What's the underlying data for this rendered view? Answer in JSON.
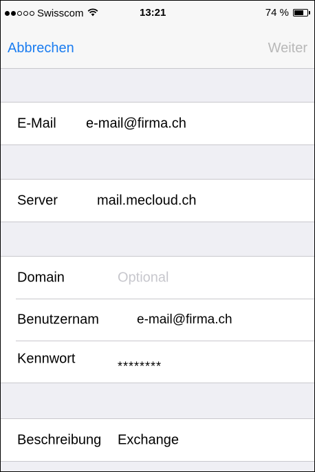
{
  "status_bar": {
    "carrier": "Swisscom",
    "time": "13:21",
    "battery": "74 %",
    "battery_level": 0.74
  },
  "nav": {
    "cancel_label": "Abbrechen",
    "next_label": "Weiter"
  },
  "form": {
    "email": {
      "label": "E-Mail",
      "value": "e-mail@firma.ch"
    },
    "server": {
      "label": "Server",
      "value": "mail.mecloud.ch"
    },
    "domain": {
      "label": "Domain",
      "placeholder": "Optional"
    },
    "username": {
      "label": "Benutzernam",
      "value": "e-mail@firma.ch"
    },
    "password": {
      "label": "Kennwort",
      "value": "********"
    },
    "description": {
      "label": "Beschreibung",
      "value": "Exchange"
    }
  }
}
